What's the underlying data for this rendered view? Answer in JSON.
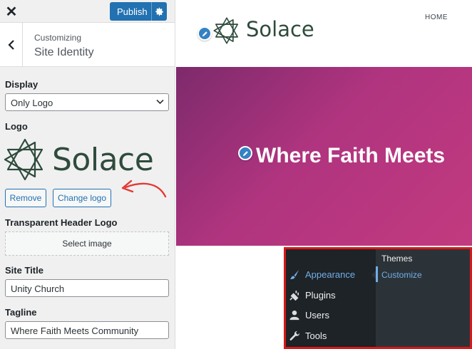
{
  "topbar": {
    "close_label": "✕",
    "publish_label": "Publish"
  },
  "section": {
    "parent": "Customizing",
    "title": "Site Identity"
  },
  "display": {
    "label": "Display",
    "selected": "Only Logo"
  },
  "logo": {
    "label": "Logo",
    "wordmark": "Solace",
    "remove_label": "Remove",
    "change_label": "Change logo"
  },
  "transparent_logo": {
    "label": "Transparent Header Logo",
    "button": "Select image"
  },
  "site_title": {
    "label": "Site Title",
    "value": "Unity Church"
  },
  "tagline": {
    "label": "Tagline",
    "value": "Where Faith Meets Community"
  },
  "preview": {
    "logo_text": "Solace",
    "nav": [
      "HOME"
    ],
    "hero_title": "Where Faith Meets",
    "hero_color": "#b0347f"
  },
  "admin_menu": {
    "items": [
      {
        "label": "Appearance",
        "icon": "paintbrush-icon",
        "active": true
      },
      {
        "label": "Plugins",
        "icon": "plug-icon",
        "active": false
      },
      {
        "label": "Users",
        "icon": "user-icon",
        "active": false
      },
      {
        "label": "Tools",
        "icon": "wrench-icon",
        "active": false
      }
    ],
    "submenu": [
      {
        "label": "Themes",
        "current": false
      },
      {
        "label": "Customize",
        "current": true
      }
    ],
    "highlight_color": "#d81818"
  },
  "colors": {
    "accent": "#2271b1",
    "logo_green": "#2f4b3c",
    "annotation_arrow": "#e53935"
  }
}
